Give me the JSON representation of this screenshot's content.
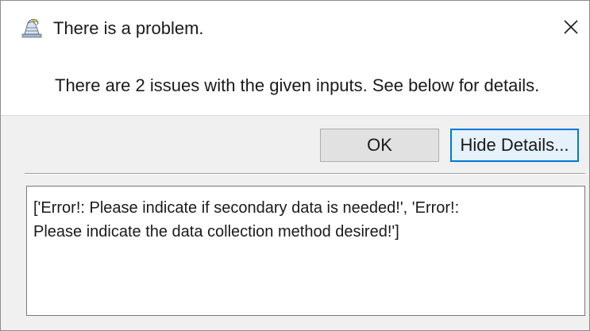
{
  "window": {
    "title": "There is a problem.",
    "app_icon": "python-tk-icon",
    "close_glyph": "✕"
  },
  "message": {
    "text": "There are 2 issues with the given inputs. See below for details."
  },
  "buttons": {
    "ok_label": "OK",
    "details_label": "Hide Details..."
  },
  "details": {
    "text": "['Error!: Please indicate if secondary data is needed!', 'Error!:\nPlease indicate the data collection method desired!']"
  },
  "colors": {
    "accent": "#0078d7",
    "button_face": "#e1e1e1",
    "panel": "#f0f0f0"
  }
}
